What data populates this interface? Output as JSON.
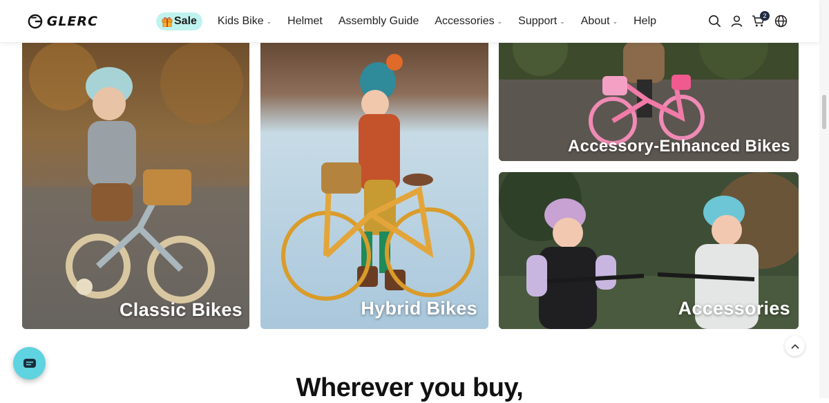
{
  "brand": {
    "name": "GLERC"
  },
  "nav": {
    "sale_label": "Sale",
    "items": [
      {
        "label": "Kids Bike",
        "has_dropdown": true
      },
      {
        "label": "Helmet",
        "has_dropdown": false
      },
      {
        "label": "Assembly Guide",
        "has_dropdown": false
      },
      {
        "label": "Accessories",
        "has_dropdown": true
      },
      {
        "label": "Support",
        "has_dropdown": true
      },
      {
        "label": "About",
        "has_dropdown": true
      },
      {
        "label": "Help",
        "has_dropdown": false
      }
    ]
  },
  "header_icons": {
    "search": "search-icon",
    "account": "user-icon",
    "cart": "cart-icon",
    "cart_count": "2",
    "language": "globe-icon"
  },
  "categories": [
    {
      "label": "Classic Bikes",
      "image": "toddler-helmet-balance-bike-photo"
    },
    {
      "label": "Hybrid Bikes",
      "image": "girl-beanie-yellow-bike-snow-photo"
    },
    {
      "label": "Accessory-Enhanced Bikes",
      "image": "child-pink-bike-doll-seat-photo"
    },
    {
      "label": "Accessories",
      "image": "two-girls-helmets-bikes-photo"
    }
  ],
  "section": {
    "headline": "Wherever you buy,"
  },
  "colors": {
    "sale_bg": "#bff3ef",
    "chat_bg": "#5fd3e0",
    "badge_bg": "#1f2a44"
  }
}
